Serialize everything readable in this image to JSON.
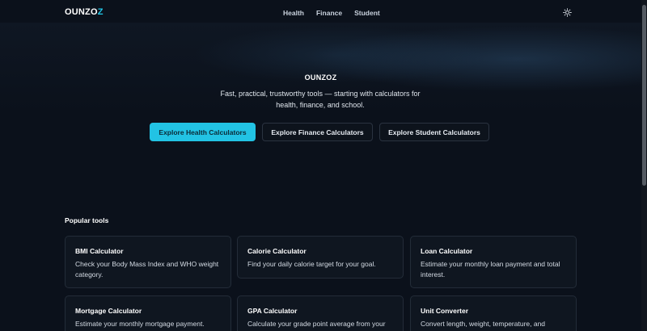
{
  "header": {
    "logo_main": "OUNZO",
    "logo_accent": "Z",
    "nav": [
      {
        "label": "Health"
      },
      {
        "label": "Finance"
      },
      {
        "label": "Student"
      }
    ],
    "theme_icon": "sun-icon"
  },
  "hero": {
    "title": "OUNZOZ",
    "subtitle": "Fast, practical, trustworthy tools — starting with calculators for health, finance, and school.",
    "buttons": {
      "health": "Explore Health Calculators",
      "finance": "Explore Finance Calculators",
      "student": "Explore Student Calculators"
    }
  },
  "popular": {
    "title": "Popular tools",
    "cards": [
      {
        "title": "BMI Calculator",
        "desc": "Check your Body Mass Index and WHO weight category."
      },
      {
        "title": "Calorie Calculator",
        "desc": "Find your daily calorie target for your goal."
      },
      {
        "title": "Loan Calculator",
        "desc": "Estimate your monthly loan payment and total interest."
      },
      {
        "title": "Mortgage Calculator",
        "desc": "Estimate your monthly mortgage payment."
      },
      {
        "title": "GPA Calculator",
        "desc": "Calculate your grade point average from your"
      },
      {
        "title": "Unit Converter",
        "desc": "Convert length, weight, temperature, and"
      }
    ]
  },
  "colors": {
    "background": "#0b111b",
    "accent": "#22c3e4",
    "card_border": "#232c38"
  }
}
